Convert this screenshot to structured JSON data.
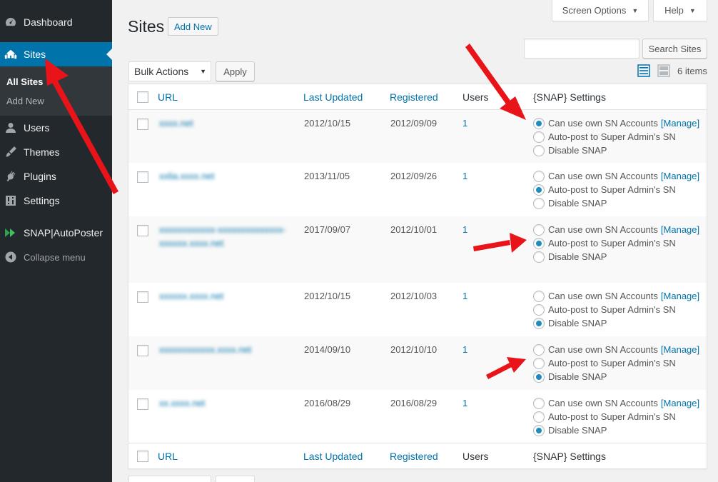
{
  "sidebar": {
    "items": [
      {
        "label": "Dashboard",
        "icon": "dashboard-icon"
      },
      {
        "label": "Sites",
        "icon": "sites-icon",
        "active": true
      },
      {
        "label": "Users",
        "icon": "users-icon"
      },
      {
        "label": "Themes",
        "icon": "themes-icon"
      },
      {
        "label": "Plugins",
        "icon": "plugins-icon"
      },
      {
        "label": "Settings",
        "icon": "settings-icon"
      },
      {
        "label": "SNAP|AutoPoster",
        "icon": "snap-icon"
      },
      {
        "label": "Collapse menu",
        "icon": "collapse-icon"
      }
    ],
    "submenu": [
      {
        "label": "All Sites",
        "current": true
      },
      {
        "label": "Add New"
      }
    ]
  },
  "top": {
    "screen_options": "Screen Options",
    "help": "Help"
  },
  "header": {
    "title": "Sites",
    "add_new": "Add New",
    "search_button": "Search Sites",
    "search_value": "",
    "bulk_select": "Bulk Actions",
    "apply": "Apply",
    "items_count": "6 items"
  },
  "table": {
    "columns": [
      "URL",
      "Last Updated",
      "Registered",
      "Users",
      "{SNAP} Settings"
    ],
    "radio_labels": [
      "Can use own SN Accounts",
      "Auto-post to Super Admin's SN",
      "Disable SNAP"
    ],
    "manage_label": "[Manage]",
    "rows": [
      {
        "url": "xxxx.net",
        "last_updated": "2012/10/15",
        "registered": "2012/09/09",
        "users": "1",
        "snap": 0
      },
      {
        "url": "xxlia.xxxx.net",
        "last_updated": "2013/11/05",
        "registered": "2012/09/26",
        "users": "1",
        "snap": 1
      },
      {
        "url": "xxxxxxxxxxxx-xxxxxxxxxxxxxx-xxxxxx.xxxx.net",
        "last_updated": "2017/09/07",
        "registered": "2012/10/01",
        "users": "1",
        "snap": 1
      },
      {
        "url": "xxxxxx.xxxx.net",
        "last_updated": "2012/10/15",
        "registered": "2012/10/03",
        "users": "1",
        "snap": 2
      },
      {
        "url": "xxxxxxxxxxxx.xxxx.net",
        "last_updated": "2014/09/10",
        "registered": "2012/10/10",
        "users": "1",
        "snap": 2
      },
      {
        "url": "xx.xxxx.net",
        "last_updated": "2016/08/29",
        "registered": "2016/08/29",
        "users": "1",
        "snap": 2
      }
    ]
  },
  "colors": {
    "sidebar_bg": "#23282d",
    "accent": "#0073aa",
    "annotation_arrow": "#e8141a"
  }
}
